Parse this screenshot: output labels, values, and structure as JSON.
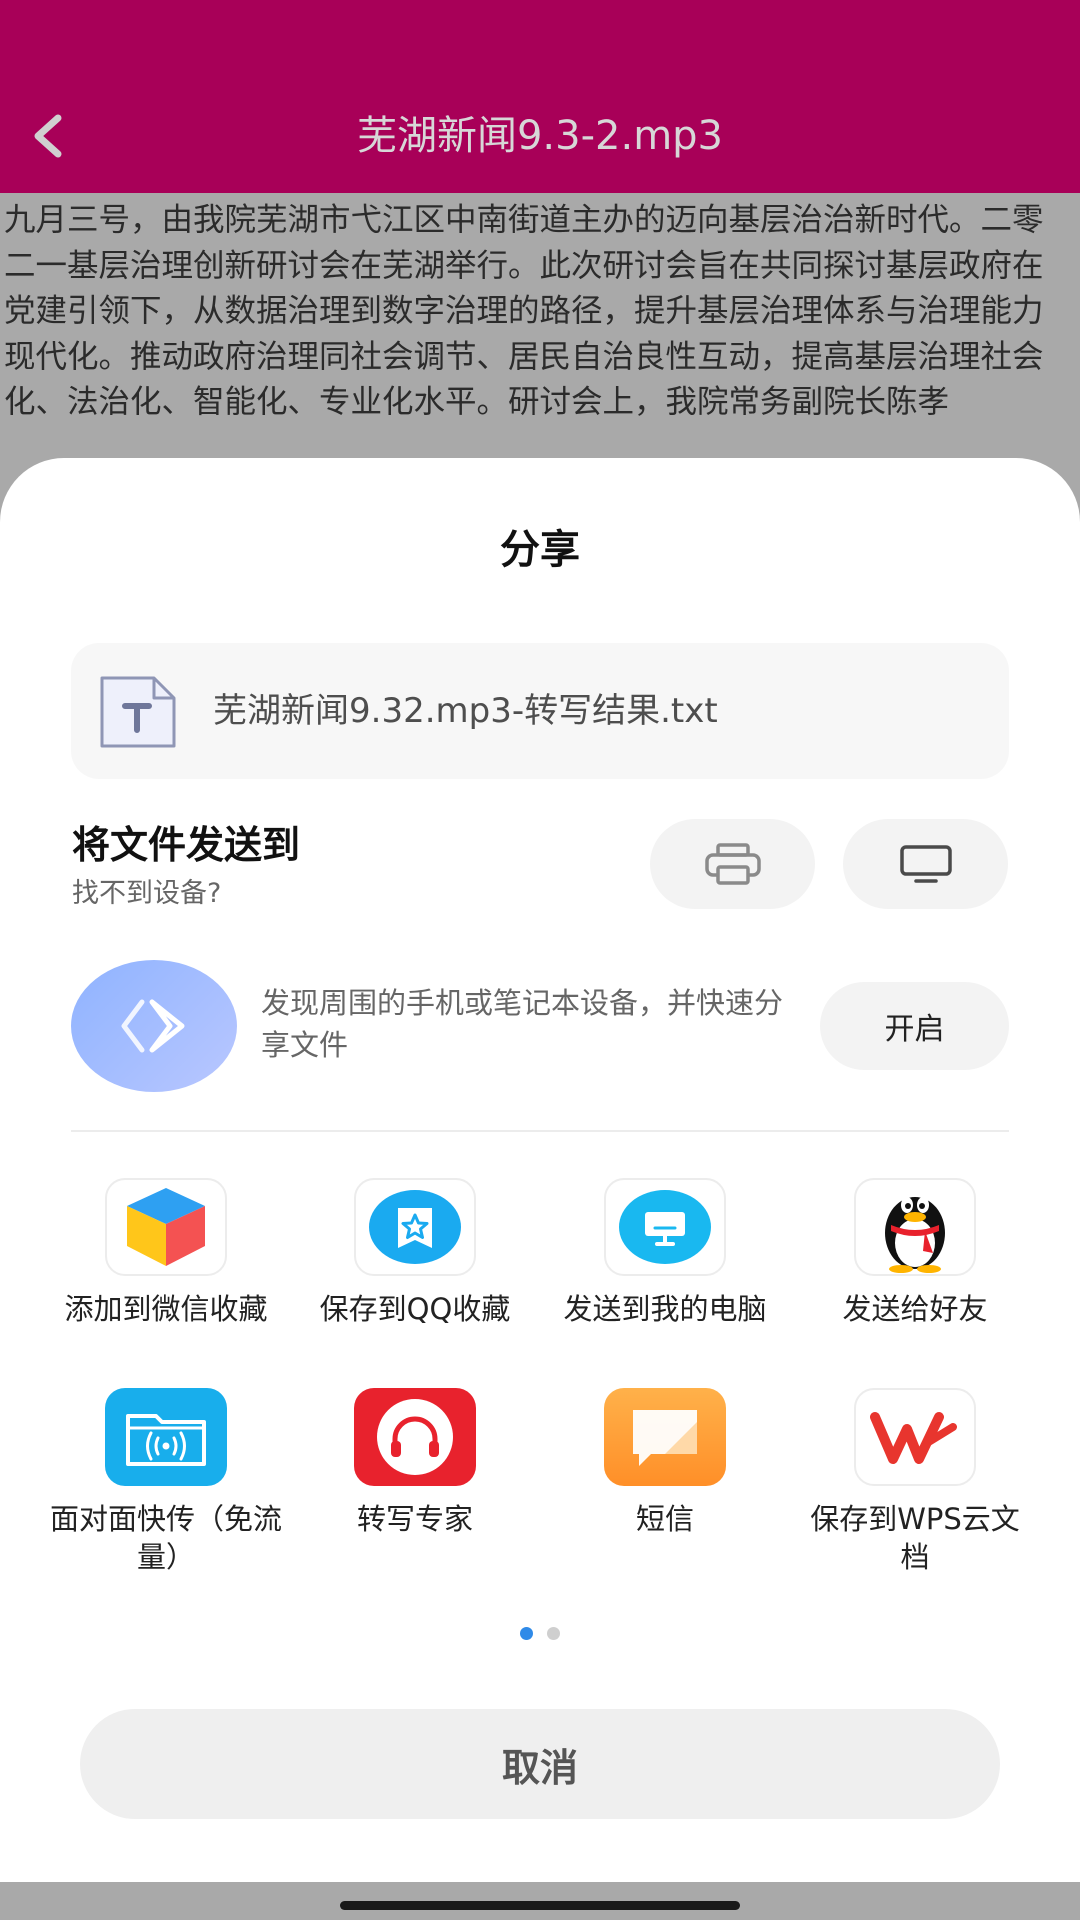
{
  "header": {
    "title": "芜湖新闻9.3-2.mp3",
    "back_icon": "chevron-left-icon"
  },
  "transcript": {
    "text": "九月三号，由我院芜湖市弋江区中南街道主办的迈向基层治治新时代。二零二一基层治理创新研讨会在芜湖举行。此次研讨会旨在共同探讨基层政府在党建引领下，从数据治理到数字治理的路径，提升基层治理体系与治理能力现代化。推动政府治理同社会调节、居民自治良性互动，提高基层治理社会化、法治化、智能化、专业化水平。研讨会上，我院常务副院长陈孝"
  },
  "share": {
    "title": "分享",
    "file": {
      "name": "芜湖新闻9.32.mp3-转写结果.txt",
      "icon": "text-file-icon"
    },
    "send": {
      "title": "将文件发送到",
      "subtitle": "找不到设备?",
      "print_icon": "printer-icon",
      "screen_icon": "monitor-icon"
    },
    "nearby": {
      "description": "发现周围的手机或笔记本设备，并快速分享文件",
      "enable_label": "开启"
    },
    "apps": [
      {
        "label": "添加到微信收藏",
        "icon": "wechat-favorites-cube-icon"
      },
      {
        "label": "保存到QQ收藏",
        "icon": "qq-favorites-star-icon"
      },
      {
        "label": "发送到我的电脑",
        "icon": "my-computer-icon"
      },
      {
        "label": "发送给好友",
        "icon": "qq-penguin-icon"
      },
      {
        "label": "面对面快传（免流量）",
        "icon": "face-to-face-transfer-icon"
      },
      {
        "label": "转写专家",
        "icon": "transcribe-headphones-icon"
      },
      {
        "label": "短信",
        "icon": "sms-message-icon"
      },
      {
        "label": "保存到WPS云文档",
        "icon": "wps-cloud-icon"
      }
    ],
    "pagination": {
      "current": 1,
      "total": 2
    },
    "cancel_label": "取消"
  },
  "colors": {
    "header_bg": "#a80058",
    "accent_blue": "#2f8ae8",
    "sheet_bg": "#ffffff"
  }
}
